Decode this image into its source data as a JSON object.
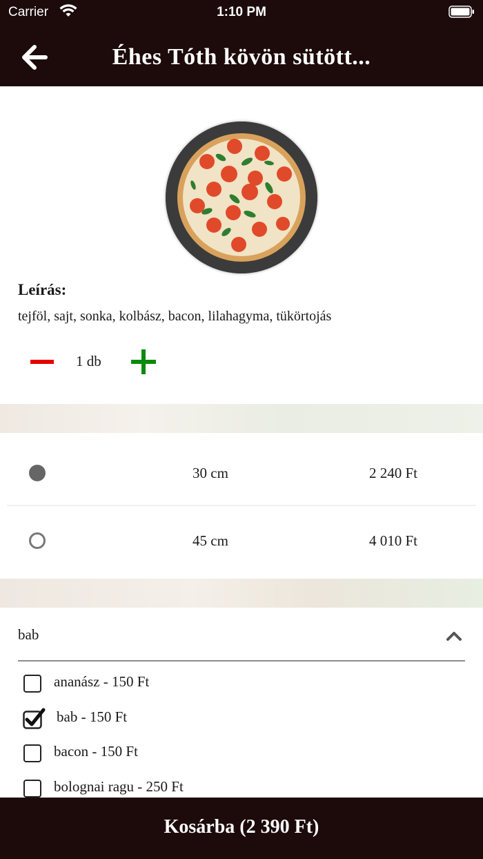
{
  "status_bar": {
    "carrier": "Carrier",
    "time": "1:10 PM"
  },
  "header": {
    "back_icon": "arrow-left-icon",
    "title": "Éhes Tóth kövön sütött..."
  },
  "product": {
    "image_icon": "pizza-image",
    "description_title": "Leírás:",
    "description": "tejföl, sajt, sonka, kolbász, bacon, lilahagyma, tükörtojás",
    "quantity_label": "1 db",
    "minus_color": "#e30000",
    "plus_color": "#0a8a0a"
  },
  "sizes": [
    {
      "label": "30 cm",
      "price": "2 240 Ft",
      "selected": true
    },
    {
      "label": "45 cm",
      "price": "4 010 Ft",
      "selected": false
    }
  ],
  "extras": {
    "title": "bab",
    "expanded": true,
    "options": [
      {
        "label": "ananász - 150 Ft",
        "checked": false
      },
      {
        "label": "bab - 150 Ft",
        "checked": true
      },
      {
        "label": "bacon - 150 Ft",
        "checked": false
      },
      {
        "label": "bolognai ragu - 250 Ft",
        "checked": false
      }
    ]
  },
  "cart_button": {
    "label": "Kosárba (2 390 Ft)"
  },
  "colors": {
    "bar_background": "#1d0b0b",
    "page_background": "#ffffff"
  }
}
